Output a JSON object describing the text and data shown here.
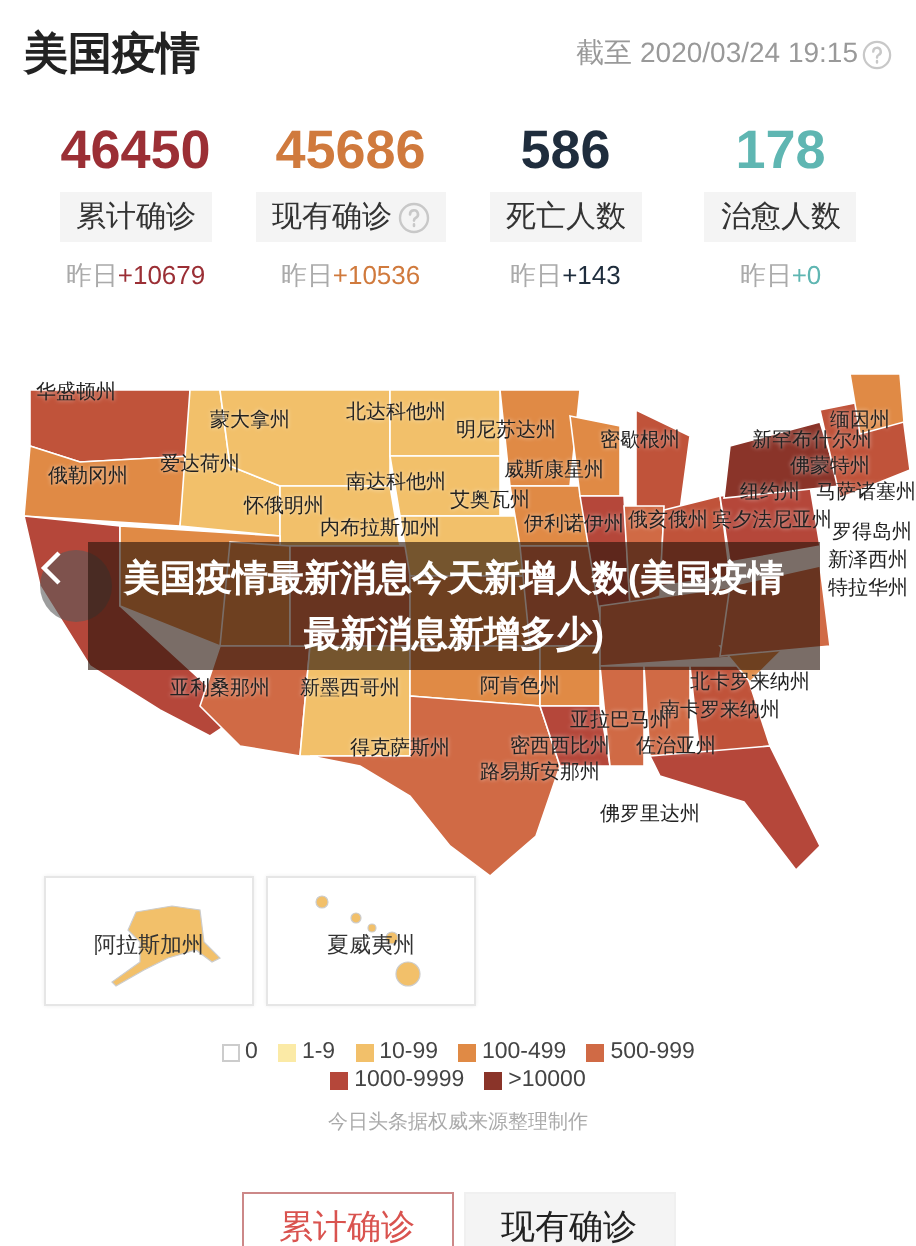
{
  "title": "美国疫情",
  "updated": "截至 2020/03/24 19:15",
  "stats": [
    {
      "value": "46450",
      "label": "累计确诊",
      "help": false,
      "delta_label": "昨日",
      "delta": "+10679",
      "color": "#9b2f35"
    },
    {
      "value": "45686",
      "label": "现有确诊",
      "help": true,
      "delta_label": "昨日",
      "delta": "+10536",
      "color": "#d07a3d"
    },
    {
      "value": "586",
      "label": "死亡人数",
      "help": false,
      "delta_label": "昨日",
      "delta": "+143",
      "color": "#1f2d3d"
    },
    {
      "value": "178",
      "label": "治愈人数",
      "help": false,
      "delta_label": "昨日",
      "delta": "+0",
      "color": "#5fb6b2"
    }
  ],
  "map": {
    "labels": [
      "华盛顿州",
      "蒙大拿州",
      "北达科他州",
      "明尼苏达州",
      "缅因州",
      "俄勒冈州",
      "爱达荷州",
      "南达科他州",
      "威斯康星州",
      "密歇根州",
      "新罕布什尔州",
      "佛蒙特州",
      "怀俄明州",
      "纽约州",
      "马萨诸塞州",
      "内布拉斯加州",
      "艾奥瓦州",
      "伊利诺伊州",
      "俄亥俄州",
      "宾夕法尼亚州",
      "罗得岛州",
      "新泽西州",
      "特拉华州",
      "亚利桑那州",
      "新墨西哥州",
      "阿肯色州",
      "北卡罗来纳州",
      "南卡罗来纳州",
      "亚拉巴马州",
      "密西西比州",
      "佐治亚州",
      "路易斯安那州",
      "得克萨斯州",
      "佛罗里达州"
    ],
    "caption": "美国疫情最新消息今天新增人数(美国疫情最新消息新增多少)"
  },
  "insets": [
    {
      "kind": "alaska",
      "label": "阿拉斯加州"
    },
    {
      "kind": "hawaii",
      "label": "夏威夷州"
    }
  ],
  "legend": [
    {
      "label": "0",
      "color": "#ffffff"
    },
    {
      "label": "1-9",
      "color": "#fbeaa6"
    },
    {
      "label": "10-99",
      "color": "#f2c06a"
    },
    {
      "label": "100-499",
      "color": "#e08a45"
    },
    {
      "label": "500-999",
      "color": "#d06a45"
    },
    {
      "label": "1000-9999",
      "color": "#b5473a"
    },
    {
      "label": ">10000",
      "color": "#8a3429"
    }
  ],
  "source_note": "今日头条据权威来源整理制作",
  "tabs": [
    {
      "label": "累计确诊",
      "selected": true
    },
    {
      "label": "现有确诊",
      "selected": false
    }
  ]
}
